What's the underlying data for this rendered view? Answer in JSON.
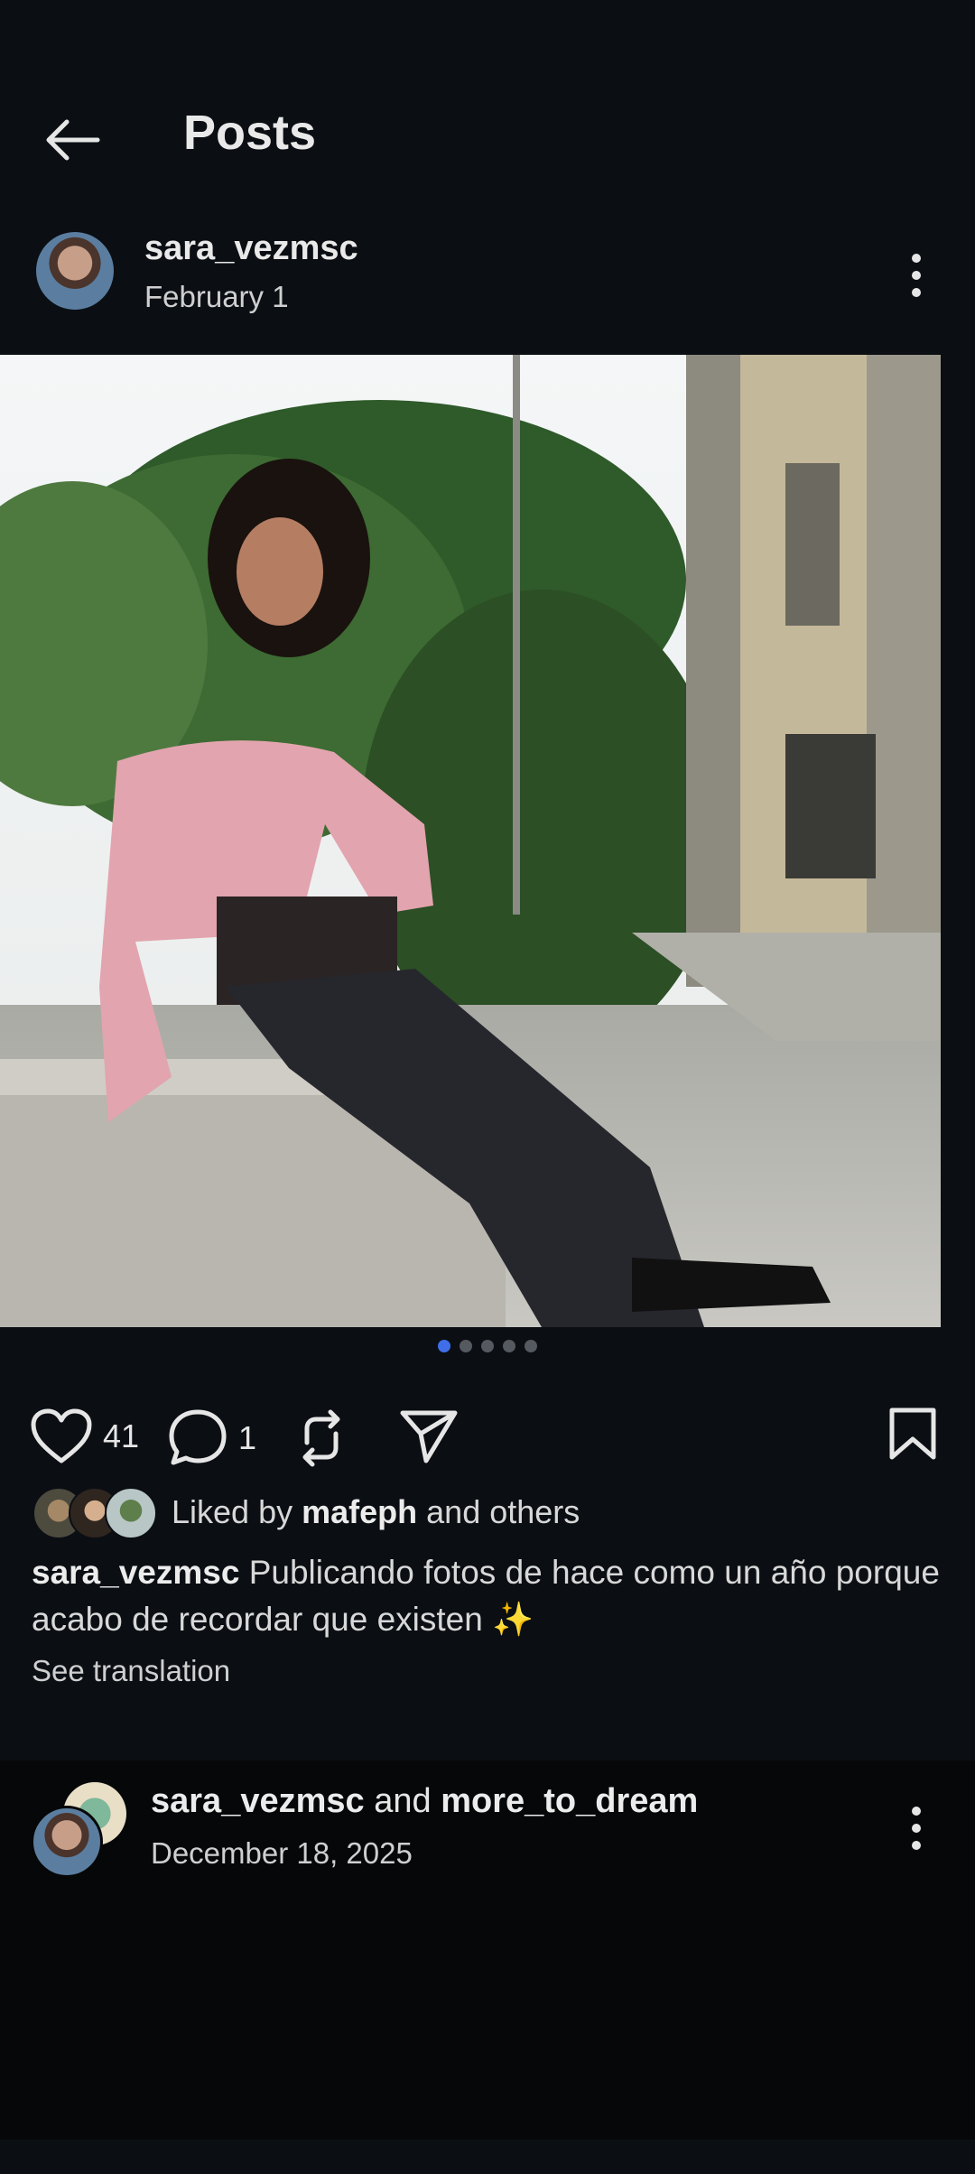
{
  "header": {
    "title": "Posts"
  },
  "post": {
    "username": "sara_vezmsc",
    "date": "February 1",
    "likes": "41",
    "comments": "1",
    "liked_by_prefix": "Liked by",
    "liked_by_user": "mafeph",
    "liked_by_suffix": "and others",
    "caption_user": "sara_vezmsc",
    "caption_text": "Publicando fotos de hace como un año porque acabo de recordar que existen ✨",
    "see_translation": "See translation",
    "carousel_count": 5,
    "carousel_active": 1
  },
  "next_post": {
    "user1": "sara_vezmsc",
    "joiner": "and",
    "user2": "more_to_dream",
    "date": "December 18, 2025"
  },
  "colors": {
    "background": "#0b0f14",
    "carousel_active": "#3f6ee8",
    "carousel_inactive": "#555a60"
  }
}
